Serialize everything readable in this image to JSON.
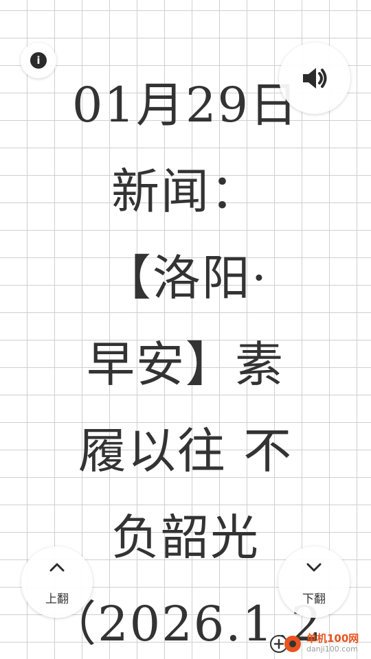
{
  "reader": {
    "lines": [
      "01月29日",
      "新闻：",
      "【洛阳·",
      "早安】素",
      "履以往 不",
      "负韶光",
      "（2026.1.2"
    ]
  },
  "controls": {
    "info_icon": "info-icon",
    "info_glyph": "i",
    "sound_icon": "speaker-icon",
    "prev_icon": "chevron-up-icon",
    "prev_label": "上翻",
    "next_icon": "chevron-down-icon",
    "next_label": "下翻"
  },
  "watermark": {
    "brand": "单机100网",
    "domain": "danji100.com",
    "brand_color": "#e8531f"
  },
  "colors": {
    "text": "#333333",
    "grid": "#cfcfcf",
    "background": "#ffffff"
  }
}
